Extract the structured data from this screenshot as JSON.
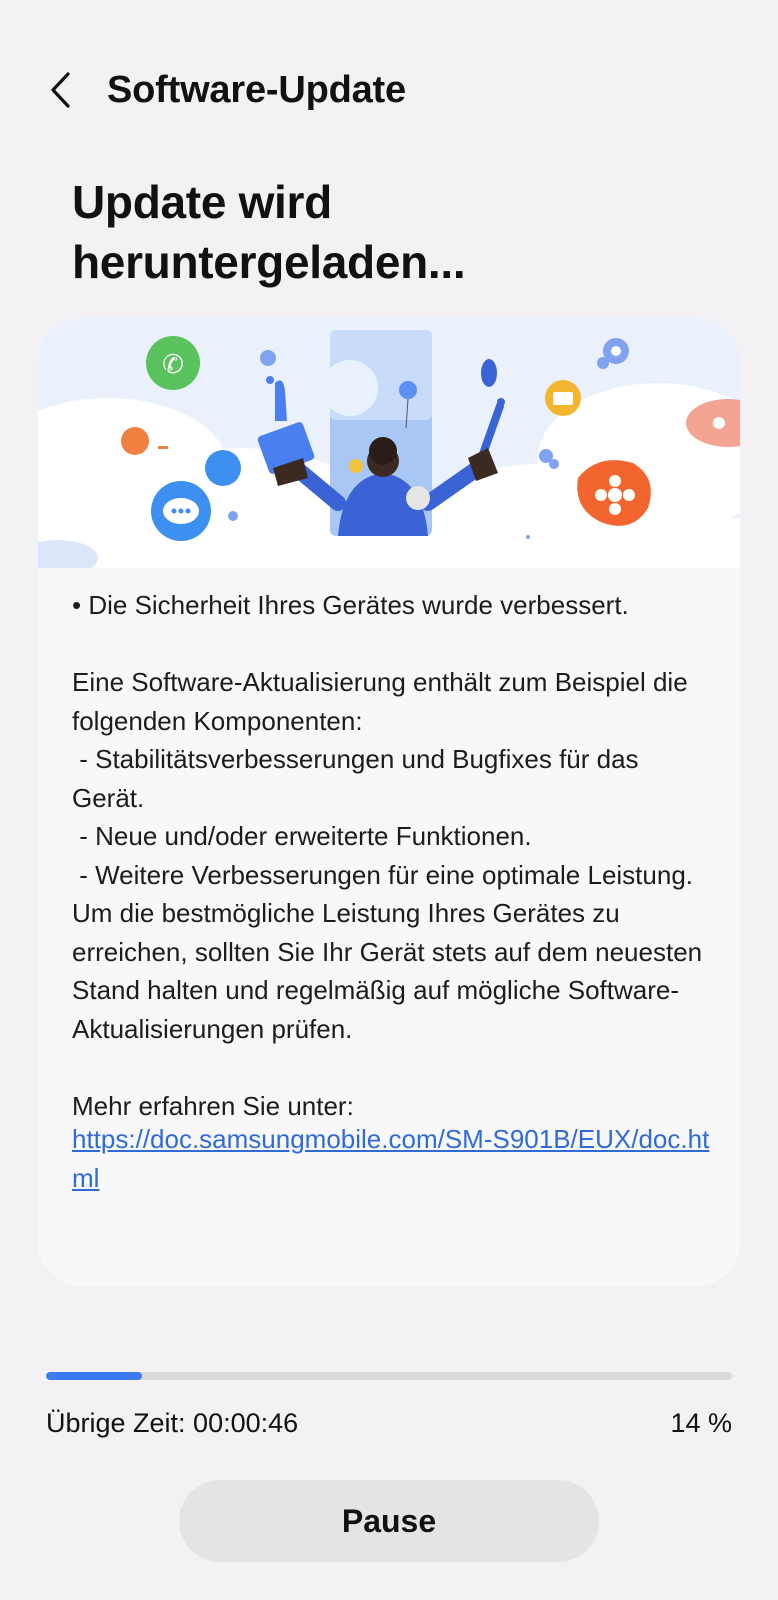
{
  "header": {
    "title": "Software-Update",
    "back_icon": "chevron-left-icon"
  },
  "status": {
    "heading": "Update wird heruntergeladen..."
  },
  "illustration": {
    "name": "update-illustration",
    "accent": "#4a7ff0"
  },
  "release_notes": {
    "text": "• Die Sicherheit Ihres Gerätes wurde verbessert.\n\nEine Software-Aktualisierung enthält zum Beispiel die folgenden Komponenten:\n - Stabilitätsverbesserungen und Bugfixes für das Gerät.\n - Neue und/oder erweiterte Funktionen.\n - Weitere Verbesserungen für eine optimale Leistung.\nUm die bestmögliche Leistung Ihres Gerätes zu erreichen, sollten Sie Ihr Gerät stets auf dem neuesten Stand halten und regelmäßig auf mögliche Software-Aktualisierungen prüfen.\n\nMehr erfahren Sie unter:",
    "link": "https://doc.samsungmobile.com/SM-S901B/EUX/doc.html"
  },
  "progress": {
    "fraction": 0.14,
    "remaining_label": "Übrige Zeit: 00:00:46",
    "percent_label": "14 %",
    "color": "#3d7bf2"
  },
  "actions": {
    "pause_label": "Pause"
  }
}
